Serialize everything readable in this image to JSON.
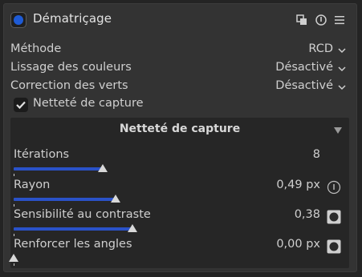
{
  "module": {
    "title": "Dématriçage",
    "accent_color": "#1e5bd6",
    "header_icons": [
      "presets-icon",
      "reset-icon",
      "menu-icon"
    ]
  },
  "settings": [
    {
      "label": "Méthode",
      "value": "RCD"
    },
    {
      "label": "Lissage des couleurs",
      "value": "Désactivé"
    },
    {
      "label": "Correction des verts",
      "value": "Désactivé"
    }
  ],
  "capture_sharpening": {
    "checkbox_label": "Netteté de capture",
    "checked": true,
    "section_title": "Netteté de capture",
    "sliders": [
      {
        "label": "Itérations",
        "value": "8",
        "fraction": 0.27,
        "icon": null
      },
      {
        "label": "Rayon",
        "value": "0,49 px",
        "fraction": 0.31,
        "icon": "info-icon"
      },
      {
        "label": "Sensibilité au contraste",
        "value": "0,38",
        "fraction": 0.36,
        "icon": "mask-toggle-icon"
      },
      {
        "label": "Renforcer les angles",
        "value": "0,00 px",
        "fraction": 0.0,
        "icon": "mask-toggle-icon"
      }
    ]
  }
}
